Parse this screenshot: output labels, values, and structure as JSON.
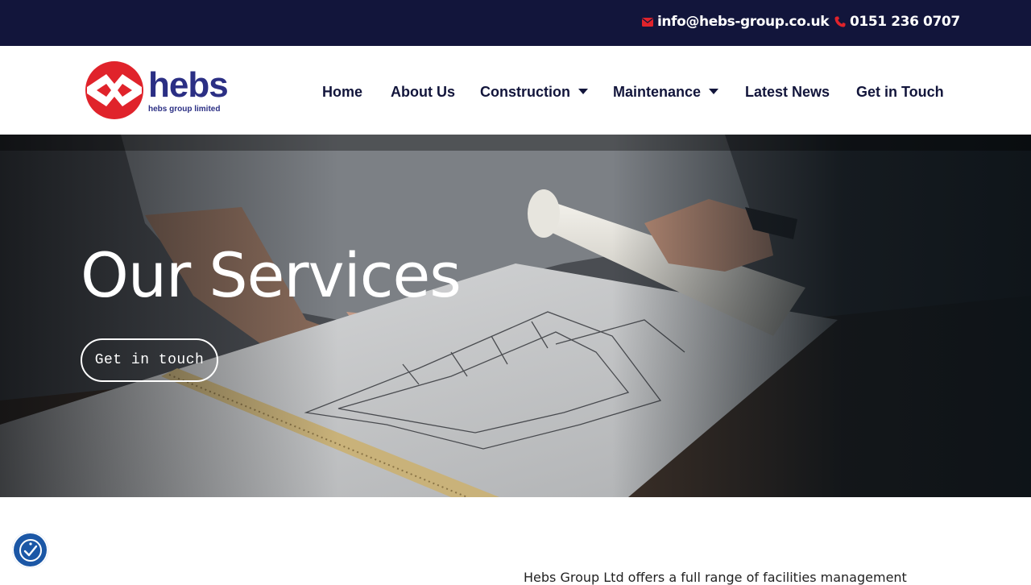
{
  "topbar": {
    "email": "info@hebs-group.co.uk",
    "phone": "0151 236 0707",
    "email_icon": "envelope-icon",
    "phone_icon": "phone-icon",
    "icon_color": "#e0232b",
    "background": "#12153b"
  },
  "logo": {
    "word": "hebs",
    "subtitle": "hebs group limited",
    "colors": {
      "red": "#e0232b",
      "blue": "#2b2f84"
    }
  },
  "nav": {
    "items": [
      {
        "label": "Home"
      },
      {
        "label": "About Us"
      },
      {
        "label": "Construction",
        "has_dropdown": true
      },
      {
        "label": "Maintenance",
        "has_dropdown": true
      },
      {
        "label": "Latest News"
      },
      {
        "label": "Get in Touch"
      }
    ]
  },
  "hero": {
    "title": "Our Services",
    "button_label": "Get in touch"
  },
  "intro": {
    "text": "Hebs Group Ltd offers a full range of facilities management"
  },
  "accessibility": {
    "icon": "accessibility-icon",
    "color": "#1b57a6"
  }
}
